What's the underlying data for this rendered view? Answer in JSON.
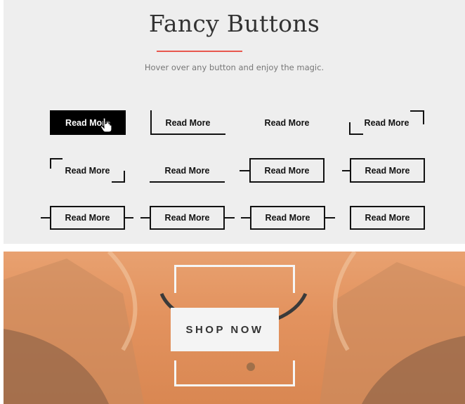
{
  "header": {
    "title": "Fancy Buttons",
    "subtitle": "Hover over any button and enjoy the magic."
  },
  "buttons": {
    "label": "Read More"
  },
  "promo": {
    "cta_label": "SHOP NOW"
  },
  "colors": {
    "accent": "#e8584e",
    "panel_bg": "#eeeeee",
    "button_text": "#111111",
    "promo_overlay": "#e8a170"
  },
  "icons": {
    "cursor": "hand-pointer-icon"
  }
}
